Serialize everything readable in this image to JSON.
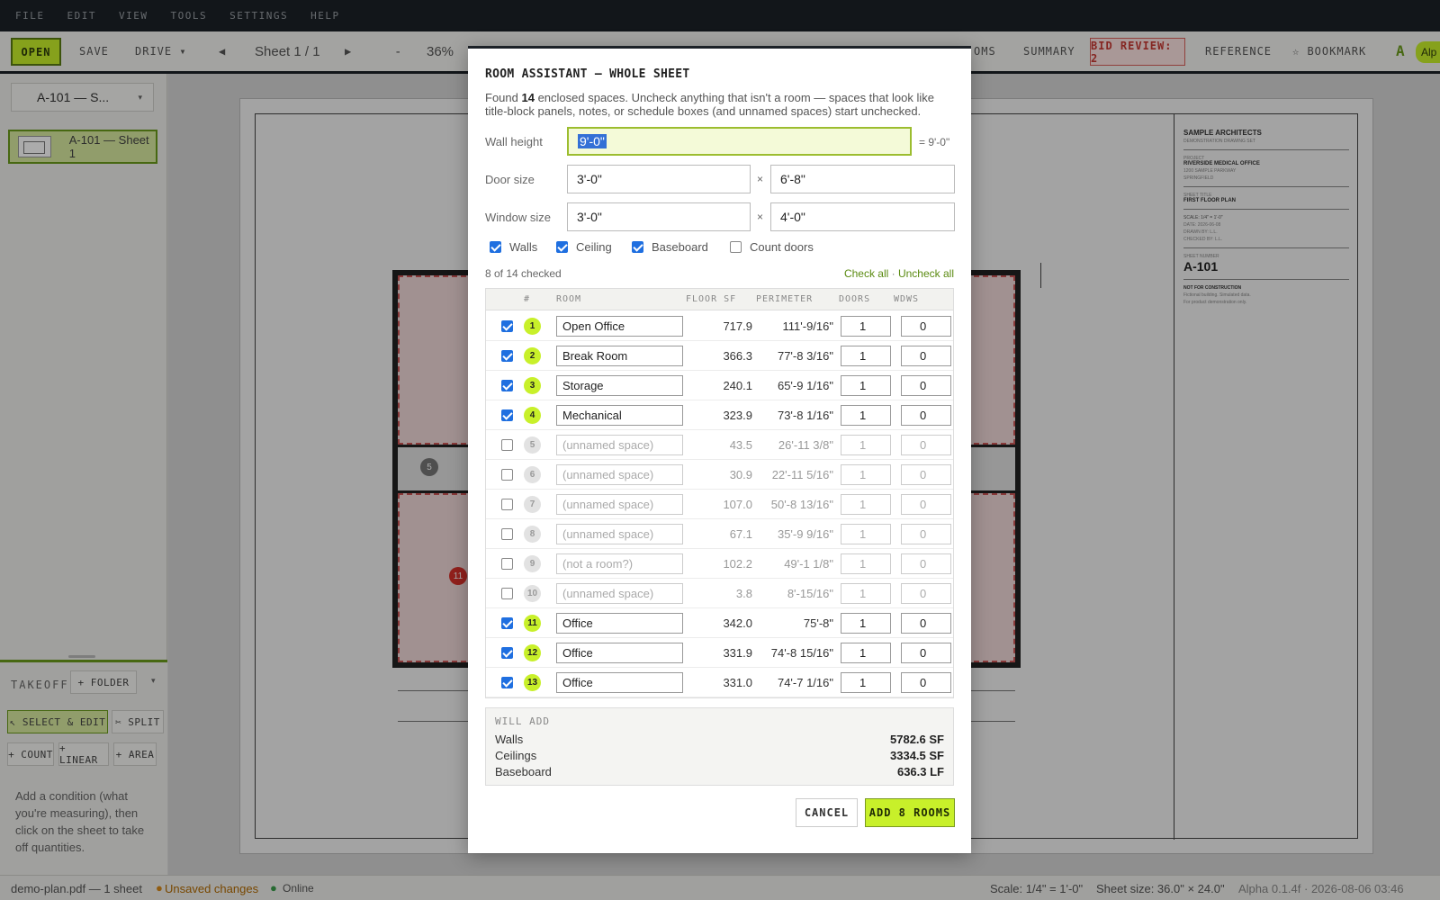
{
  "menu": [
    "FILE",
    "EDIT",
    "VIEW",
    "TOOLS",
    "SETTINGS",
    "HELP"
  ],
  "toolbar": {
    "open": "OPEN",
    "save": "SAVE",
    "drive": "DRIVE ▾",
    "prev": "◀",
    "sheet": "Sheet 1 / 1",
    "next": "▶",
    "zoom_out": "-",
    "zoom": "36%",
    "rooms": "OMS",
    "summary": "SUMMARY",
    "bid_review": "BID REVIEW: 2",
    "reference": "REFERENCE",
    "bookmark": "☆ BOOKMARK",
    "a": "A",
    "alpha": "Alp"
  },
  "sidebar": {
    "sheet_select": "A-101 — S...",
    "sheet_item": "A-101 — Sheet 1",
    "takeoff": "TAKEOFF",
    "folder": "+ FOLDER",
    "select_edit": "↖ SELECT & EDIT",
    "split": "✂ SPLIT",
    "count": "+ COUNT",
    "linear": "+ LINEAR",
    "area": "+ AREA",
    "help": "Add a condition (what you're measuring), then click on the sheet to take off quantities."
  },
  "titleblock": {
    "firm": "SAMPLE ARCHITECTS",
    "firm_sub": "DEMONSTRATION DRAWING SET",
    "project_label": "PROJECT",
    "project": "RIVERSIDE MEDICAL OFFICE",
    "address": "1200 SAMPLE PARKWAY",
    "city": "SPRINGFIELD",
    "sheet_title_label": "SHEET TITLE",
    "sheet_title": "FIRST FLOOR PLAN",
    "scale": "SCALE:  1/4\" = 1'-0\"",
    "date": "DATE:  2026-06-08",
    "drawn": "DRAWN BY:   L.L.",
    "checked": "CHECKED BY:   L.L.",
    "sheet_no_label": "SHEET NUMBER",
    "sheet_no": "A-101",
    "nfc": "NOT FOR CONSTRUCTION",
    "nfc_sub1": "Fictional building. Simulated data.",
    "nfc_sub2": "For product demonstration only."
  },
  "plan_badges": {
    "five": "5",
    "eleven": "11"
  },
  "status": {
    "file": "demo-plan.pdf — 1 sheet",
    "unsaved": "Unsaved changes",
    "online": "Online",
    "scale": "Scale: 1/4\" = 1'-0\"",
    "size": "Sheet size: 36.0\" × 24.0\"",
    "version": "Alpha 0.1.4f · 2026-08-06 03:46"
  },
  "modal": {
    "title": "ROOM ASSISTANT — WHOLE SHEET",
    "desc_pre": "Found ",
    "desc_count": "14",
    "desc_post": " enclosed spaces. Uncheck anything that isn't a room — spaces that look like title-block panels, notes, or schedule boxes (and unnamed spaces) start unchecked.",
    "wall_height_label": "Wall height",
    "wall_height": "9'-0\"",
    "wall_height_eq": "= 9'-0\"",
    "door_label": "Door size",
    "door_w": "3'-0\"",
    "door_h": "6'-8\"",
    "window_label": "Window size",
    "window_w": "3'-0\"",
    "window_h": "4'-0\"",
    "times": "×",
    "opts": [
      {
        "label": "Walls",
        "checked": true
      },
      {
        "label": "Ceiling",
        "checked": true
      },
      {
        "label": "Baseboard",
        "checked": true
      },
      {
        "label": "Count doors",
        "checked": false
      }
    ],
    "checked_count": "8 of 14 checked",
    "check_all": "Check all",
    "sep": " · ",
    "uncheck_all": "Uncheck all",
    "columns": [
      "#",
      "ROOM",
      "FLOOR SF",
      "PERIMETER",
      "DOORS",
      "WDWS"
    ],
    "rooms": [
      {
        "n": "1",
        "name": "Open Office",
        "sf": "717.9",
        "perim": "111'-9/16\"",
        "doors": "1",
        "wdws": "0",
        "checked": true
      },
      {
        "n": "2",
        "name": "Break Room",
        "sf": "366.3",
        "perim": "77'-8 3/16\"",
        "doors": "1",
        "wdws": "0",
        "checked": true
      },
      {
        "n": "3",
        "name": "Storage",
        "sf": "240.1",
        "perim": "65'-9 1/16\"",
        "doors": "1",
        "wdws": "0",
        "checked": true
      },
      {
        "n": "4",
        "name": "Mechanical",
        "sf": "323.9",
        "perim": "73'-8 1/16\"",
        "doors": "1",
        "wdws": "0",
        "checked": true
      },
      {
        "n": "5",
        "name": "(unnamed space)",
        "sf": "43.5",
        "perim": "26'-11 3/8\"",
        "doors": "1",
        "wdws": "0",
        "checked": false
      },
      {
        "n": "6",
        "name": "(unnamed space)",
        "sf": "30.9",
        "perim": "22'-11 5/16\"",
        "doors": "1",
        "wdws": "0",
        "checked": false
      },
      {
        "n": "7",
        "name": "(unnamed space)",
        "sf": "107.0",
        "perim": "50'-8 13/16\"",
        "doors": "1",
        "wdws": "0",
        "checked": false
      },
      {
        "n": "8",
        "name": "(unnamed space)",
        "sf": "67.1",
        "perim": "35'-9 9/16\"",
        "doors": "1",
        "wdws": "0",
        "checked": false
      },
      {
        "n": "9",
        "name": "(not a room?)",
        "sf": "102.2",
        "perim": "49'-1 1/8\"",
        "doors": "1",
        "wdws": "0",
        "checked": false
      },
      {
        "n": "10",
        "name": "(unnamed space)",
        "sf": "3.8",
        "perim": "8'-15/16\"",
        "doors": "1",
        "wdws": "0",
        "checked": false
      },
      {
        "n": "11",
        "name": "Office",
        "sf": "342.0",
        "perim": "75'-8\"",
        "doors": "1",
        "wdws": "0",
        "checked": true
      },
      {
        "n": "12",
        "name": "Office",
        "sf": "331.9",
        "perim": "74'-8 15/16\"",
        "doors": "1",
        "wdws": "0",
        "checked": true
      },
      {
        "n": "13",
        "name": "Office",
        "sf": "331.0",
        "perim": "74'-7 1/16\"",
        "doors": "1",
        "wdws": "0",
        "checked": true
      }
    ],
    "will_add_label": "WILL ADD",
    "totals": [
      {
        "label": "Walls",
        "value": "5782.6 SF"
      },
      {
        "label": "Ceilings",
        "value": "3334.5 SF"
      },
      {
        "label": "Baseboard",
        "value": "636.3 LF"
      }
    ],
    "cancel": "CANCEL",
    "add": "ADD 8 ROOMS"
  },
  "colors": {
    "accent": "#c8f02a",
    "dark": "#1c2127",
    "alert": "#c73a33"
  }
}
